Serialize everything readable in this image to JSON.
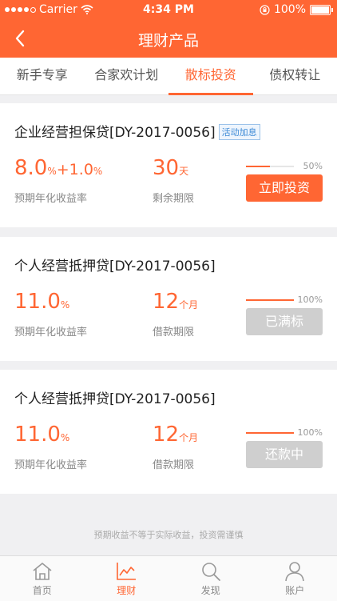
{
  "status_bar": {
    "carrier": "Carrier",
    "time": "4:34 PM",
    "battery": "100%"
  },
  "nav": {
    "title": "理财产品"
  },
  "tabs": [
    {
      "label": "新手专享"
    },
    {
      "label": "合家欢计划"
    },
    {
      "label": "散标投资",
      "active": true
    },
    {
      "label": "债权转让"
    }
  ],
  "products": [
    {
      "name": "企业经营担保贷[DY-2017-0056]",
      "tag": "活动加息",
      "rate_main": "8.0",
      "rate_unit": "%",
      "rate_extra": "+1.0",
      "rate_extra_unit": "%",
      "rate_label": "预期年化收益率",
      "term_value": "30",
      "term_unit": "天",
      "term_label": "剩余期限",
      "progress_text": "50%",
      "progress": 0.5,
      "button": "立即投资",
      "button_state": "primary"
    },
    {
      "name": "个人经营抵押贷[DY-2017-0056]",
      "rate_main": "11.0",
      "rate_unit": "%",
      "rate_label": "预期年化收益率",
      "term_value": "12",
      "term_unit": "个月",
      "term_label": "借款期限",
      "progress_text": "100%",
      "progress": 1.0,
      "button": "已满标",
      "button_state": "disabled"
    },
    {
      "name": "个人经营抵押贷[DY-2017-0056]",
      "rate_main": "11.0",
      "rate_unit": "%",
      "rate_label": "预期年化收益率",
      "term_value": "12",
      "term_unit": "个月",
      "term_label": "借款期限",
      "progress_text": "100%",
      "progress": 1.0,
      "button": "还款中",
      "button_state": "disabled"
    }
  ],
  "footer_note": "预期收益不等于实际收益，投资需谨慎",
  "tabbar": [
    {
      "label": "首页",
      "icon": "home-icon"
    },
    {
      "label": "理财",
      "icon": "chart-icon",
      "active": true
    },
    {
      "label": "发现",
      "icon": "search-icon"
    },
    {
      "label": "账户",
      "icon": "user-icon"
    }
  ],
  "colors": {
    "accent": "#ff6633",
    "disabled": "#cfcfcf",
    "tag": "#3d8ad6"
  }
}
